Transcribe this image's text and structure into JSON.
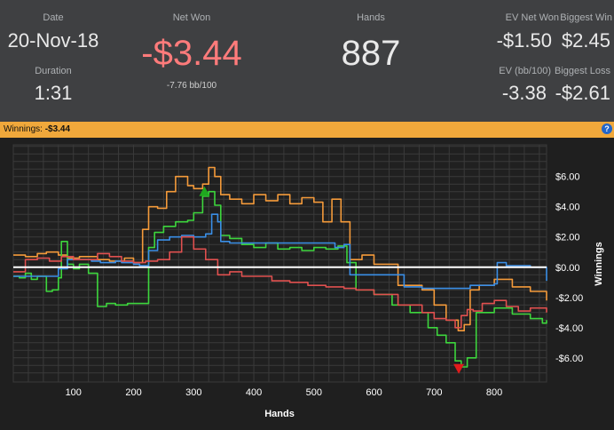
{
  "stats": {
    "date_label": "Date",
    "date_value": "20-Nov-18",
    "duration_label": "Duration",
    "duration_value": "1:31",
    "net_won_label": "Net Won",
    "net_won_value": "-$3.44",
    "net_won_bb": "-7.76 bb/100",
    "hands_label": "Hands",
    "hands_value": "887",
    "ev_net_won_label": "EV Net Won",
    "ev_net_won_value": "-$1.50",
    "biggest_win_label": "Biggest Win",
    "biggest_win_value": "$2.45",
    "ev_bb_label": "EV (bb/100)",
    "ev_bb_value": "-3.38",
    "biggest_loss_label": "Biggest Loss",
    "biggest_loss_value": "-$2.61"
  },
  "winnings_bar": {
    "label": "Winnings:",
    "value": "-$3.44",
    "help_icon": "?"
  },
  "colors": {
    "net_won": "#ff7b7b",
    "background": "#1f1f1f",
    "grid": "#3a3a3a",
    "bar": "#f0a83b",
    "series_green": "#3dd63d",
    "series_orange": "#f49a3a",
    "series_blue": "#3a8ee6",
    "series_red": "#e0504f",
    "zero_line": "#ffffff",
    "max_marker": "#1fa81f",
    "min_marker": "#e01b1b"
  },
  "chart_data": {
    "type": "line",
    "xlabel": "Hands",
    "ylabel": "Winnings",
    "xlim": [
      0,
      887
    ],
    "ylim": [
      -7.6,
      8.1
    ],
    "x_ticks": [
      "100",
      "200",
      "300",
      "400",
      "500",
      "600",
      "700",
      "800"
    ],
    "x_tick_values": [
      100,
      200,
      300,
      400,
      500,
      600,
      700,
      800
    ],
    "y_ticks": [
      "$6.00",
      "$4.00",
      "$2.00",
      "$0.00",
      "-$2.00",
      "-$4.00",
      "-$6.00"
    ],
    "y_tick_values": [
      6,
      4,
      2,
      0,
      -2,
      -4,
      -6
    ],
    "grid": true,
    "legend": "none",
    "markers": [
      {
        "name": "max",
        "x": 318,
        "y": 5.0
      },
      {
        "name": "min",
        "x": 741,
        "y": -6.7
      }
    ],
    "series": [
      {
        "color": "#f49a3a",
        "x": [
          0,
          20,
          40,
          55,
          75,
          90,
          110,
          140,
          160,
          185,
          200,
          215,
          225,
          240,
          255,
          270,
          290,
          300,
          315,
          325,
          335,
          345,
          360,
          380,
          400,
          420,
          440,
          460,
          480,
          500,
          515,
          530,
          545,
          560,
          580,
          600,
          640,
          680,
          700,
          720,
          740,
          750,
          760,
          775,
          800,
          830,
          860,
          887
        ],
        "y": [
          0.8,
          0.7,
          0.9,
          1.0,
          0.8,
          0.6,
          0.7,
          0.5,
          0.4,
          0.6,
          0.3,
          2.5,
          4.0,
          3.9,
          5.0,
          6.0,
          5.4,
          5.2,
          5.5,
          6.6,
          6.0,
          4.8,
          4.5,
          4.2,
          4.8,
          4.4,
          4.8,
          4.2,
          4.6,
          4.3,
          3.0,
          4.5,
          3.0,
          0.5,
          0.8,
          0.2,
          -1.2,
          -1.5,
          -2.5,
          -3.5,
          -4.2,
          -3.8,
          -1.5,
          -1.2,
          -0.8,
          -1.3,
          -1.6,
          -2.2
        ]
      },
      {
        "color": "#3dd63d",
        "x": [
          0,
          10,
          20,
          30,
          40,
          55,
          65,
          75,
          80,
          90,
          100,
          110,
          125,
          140,
          155,
          170,
          190,
          210,
          225,
          235,
          250,
          270,
          290,
          300,
          315,
          325,
          335,
          345,
          360,
          380,
          400,
          420,
          440,
          460,
          480,
          500,
          520,
          540,
          555,
          570,
          600,
          630,
          660,
          690,
          705,
          720,
          735,
          745,
          755,
          770,
          800,
          830,
          860,
          880,
          887
        ],
        "y": [
          -0.6,
          -0.7,
          -0.4,
          -0.8,
          -0.6,
          -1.6,
          -1.5,
          -0.7,
          1.7,
          0.2,
          -0.1,
          0.2,
          -0.4,
          -2.6,
          -2.4,
          -2.5,
          -2.4,
          -2.4,
          1.3,
          2.3,
          2.7,
          3.0,
          3.1,
          3.6,
          4.7,
          5.0,
          4.1,
          2.1,
          1.9,
          1.5,
          1.3,
          1.6,
          1.2,
          1.3,
          1.1,
          1.3,
          1.2,
          1.4,
          0.3,
          -1.5,
          -1.8,
          -2.5,
          -3.0,
          -4.0,
          -4.5,
          -5.0,
          -6.2,
          -6.6,
          -6.0,
          -3.0,
          -2.7,
          -3.1,
          -3.4,
          -3.7,
          -3.5
        ]
      },
      {
        "color": "#3a8ee6",
        "x": [
          0,
          30,
          60,
          75,
          90,
          110,
          130,
          145,
          160,
          170,
          180,
          200,
          210,
          225,
          240,
          260,
          280,
          300,
          320,
          330,
          340,
          345,
          360,
          400,
          450,
          500,
          535,
          550,
          560,
          580,
          650,
          680,
          700,
          740,
          760,
          800,
          805,
          820,
          860,
          887
        ],
        "y": [
          -0.6,
          -0.6,
          -0.6,
          -0.1,
          0.5,
          0.5,
          0.4,
          0.3,
          0.3,
          0.4,
          0.3,
          0.2,
          0.1,
          1.1,
          1.8,
          2.0,
          2.1,
          2.0,
          2.2,
          3.5,
          3.0,
          1.7,
          1.6,
          1.6,
          1.6,
          1.6,
          1.3,
          1.5,
          -0.5,
          -0.5,
          -1.3,
          -1.4,
          -1.4,
          -1.4,
          -1.2,
          -1.1,
          0.3,
          0.1,
          0.0,
          -0.9
        ]
      },
      {
        "color": "#e0504f",
        "x": [
          0,
          20,
          40,
          60,
          80,
          100,
          120,
          140,
          160,
          180,
          200,
          220,
          240,
          260,
          280,
          300,
          320,
          340,
          360,
          380,
          400,
          430,
          460,
          490,
          520,
          550,
          570,
          600,
          640,
          680,
          700,
          720,
          735,
          745,
          755,
          765,
          780,
          800,
          820,
          840,
          860,
          887
        ],
        "y": [
          -0.3,
          0.5,
          0.6,
          0.4,
          0.7,
          0.5,
          0.5,
          0.9,
          0.7,
          0.4,
          0.3,
          0.4,
          0.5,
          1.0,
          2.0,
          1.2,
          0.5,
          -0.5,
          -0.3,
          -0.6,
          -0.6,
          -0.9,
          -1.0,
          -1.2,
          -1.3,
          -1.4,
          -1.5,
          -1.8,
          -2.5,
          -3.0,
          -3.4,
          -3.5,
          -4.0,
          -3.2,
          -2.8,
          -2.9,
          -2.4,
          -2.2,
          -2.6,
          -2.9,
          -2.7,
          -3.0
        ]
      }
    ]
  }
}
